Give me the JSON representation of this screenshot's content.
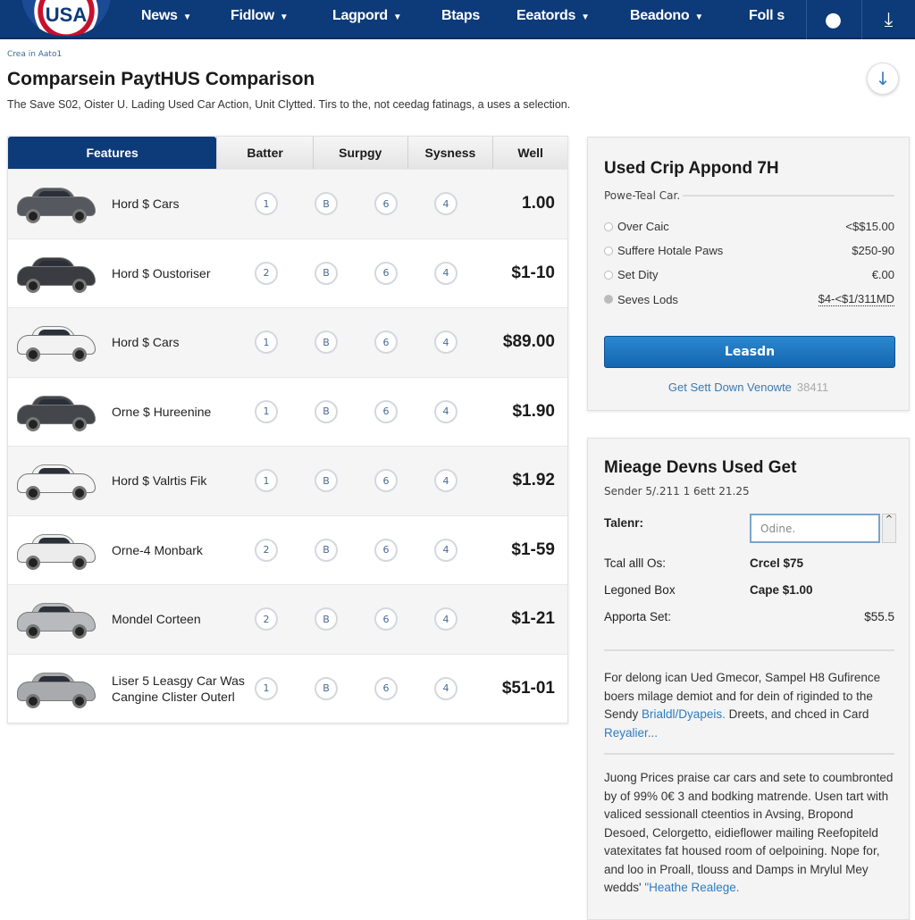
{
  "nav": {
    "logo": "USA",
    "items": [
      {
        "label": "News",
        "dropdown": true
      },
      {
        "label": "Fidlow",
        "dropdown": true
      },
      {
        "label": "Lagpord",
        "dropdown": true
      },
      {
        "label": "Btaps",
        "dropdown": false
      },
      {
        "label": "Eeatords",
        "dropdown": true
      },
      {
        "label": "Beadono",
        "dropdown": true
      },
      {
        "label": "Foll s",
        "dropdown": false
      }
    ],
    "icons": [
      "lightbulb-icon",
      "download-icon"
    ]
  },
  "breadcrumb": "Crea in Aato1",
  "page": {
    "title": "Comparsein PaytHUS Comparison",
    "description": "The Save S02, Oister U. Lading Used Car Action, Unit Clytted. Tirs to the, not ceedag fatinags, a uses a selection."
  },
  "table": {
    "headers": [
      "Features",
      "Batter",
      "Surpgy",
      "Sysness",
      "Well"
    ],
    "rows": [
      {
        "name": "Hord $ Cars",
        "car_color": "#55585e",
        "ratings": [
          "1",
          "B",
          "6",
          "4"
        ],
        "price": "1.00"
      },
      {
        "name": "Hord $ Oustoriser",
        "car_color": "#3a3c42",
        "ratings": [
          "2",
          "B",
          "6",
          "4"
        ],
        "price": "$1-10"
      },
      {
        "name": "Hord $ Cars",
        "car_color": "#f2f2f2",
        "ratings": [
          "1",
          "B",
          "6",
          "4"
        ],
        "price": "$89.00"
      },
      {
        "name": "Orne $ Hureenine",
        "car_color": "#44464c",
        "ratings": [
          "1",
          "B",
          "6",
          "4"
        ],
        "price": "$1.90"
      },
      {
        "name": "Hord $ Valrtis Fik",
        "car_color": "#f4f4f4",
        "ratings": [
          "1",
          "B",
          "6",
          "4"
        ],
        "price": "$1.92"
      },
      {
        "name": "Orne-4 Monbark",
        "car_color": "#ececec",
        "ratings": [
          "2",
          "B",
          "6",
          "4"
        ],
        "price": "$1-59"
      },
      {
        "name": "Mondel Corteen",
        "car_color": "#b8babd",
        "ratings": [
          "2",
          "B",
          "6",
          "4"
        ],
        "price": "$1-21"
      },
      {
        "name": "Liser 5 Leasgy Car Was Cangine Clister Outerl",
        "car_color": "#a8aaad",
        "ratings": [
          "1",
          "B",
          "6",
          "4"
        ],
        "price": "$51-01"
      }
    ]
  },
  "panel1": {
    "title": "Used Crip Appond 7H",
    "subtitle": "Powe-Teal Car.",
    "options": [
      {
        "label": "Over Caic",
        "value": "<$$15.00",
        "selected": false
      },
      {
        "label": "Suffere Hotale Paws",
        "value": "$250-90",
        "selected": false
      },
      {
        "label": "Set Dity",
        "value": "€.00",
        "selected": false
      },
      {
        "label": "Seves Lods",
        "value": "$4-<$1/311MD",
        "selected": true
      }
    ],
    "button": "Leasdn",
    "link": "Get Sett Down Venowte",
    "link_count": "38411"
  },
  "panel2": {
    "title": "Mieage Devns Used Get",
    "subtitle": "Sender 5/.211 1 6ett 21.25",
    "input_label": "Talenr:",
    "input_placeholder": "Odine.",
    "rows": [
      {
        "label": "Tcal alll Os:",
        "value": "Crcel $75"
      },
      {
        "label": "Legoned Box",
        "value": "Cape $1.00"
      },
      {
        "label": "Apporta Set:",
        "value": "$55.5"
      }
    ],
    "para1": "For delong ican Ued Gmecor, Sampel H8 Gufirence boers milage demiot and for dein of riginded to the Sendy",
    "para1_link": "Brialdl/Dyapeis.",
    "para1_b": "Dreets, and chced in Card",
    "para1_link2": "Reyalier...",
    "para2": "Juong Prices praise car cars and sete to coumbronted by of 99% 0€ 3 and bodking matrende. Usen tart with valiced sessionall cteentios in Avsing, Bropond Desoed, Celorgetto, eidieflower mailing Reefopiteld vatexitates fat housed room of oelpoining. Nope for, and loo in Proall, tlouss and Damps in Mrylul Mey wedds'",
    "para2_link": "\"Heathe Realege."
  }
}
